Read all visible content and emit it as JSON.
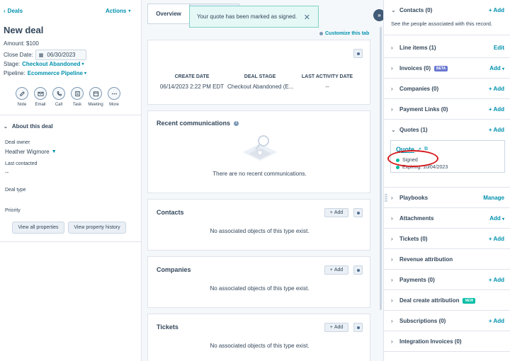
{
  "left": {
    "back_label": "Deals",
    "actions_label": "Actions",
    "title": "New deal",
    "amount": "Amount: $100",
    "close_date_label": "Close Date:",
    "close_date_value": "06/30/2023",
    "stage_label": "Stage:",
    "stage_value": "Checkout Abandoned",
    "pipeline_label": "Pipeline:",
    "pipeline_value": "Ecommerce Pipeline",
    "activities": [
      {
        "label": "Note",
        "icon": "pencil-icon"
      },
      {
        "label": "Email",
        "icon": "envelope-icon"
      },
      {
        "label": "Call",
        "icon": "phone-icon"
      },
      {
        "label": "Task",
        "icon": "task-icon"
      },
      {
        "label": "Meeting",
        "icon": "calendar-icon"
      },
      {
        "label": "More",
        "icon": "more-icon"
      }
    ],
    "about_title": "About this deal",
    "deal_owner_label": "Deal owner",
    "deal_owner_value": "Heather Wigmore",
    "last_contacted_label": "Last contacted",
    "last_contacted_value": "--",
    "deal_type_label": "Deal type",
    "priority_label": "Priority",
    "view_all_label": "View all properties",
    "view_history_label": "View property history"
  },
  "middle": {
    "tab_overview": "Overview",
    "toast_text": "Your quote has been marked as signed.",
    "customize_label": "Customize this tab",
    "summary": {
      "create_date_header": "CREATE DATE",
      "create_date_value": "06/14/2023 2:22 PM EDT",
      "deal_stage_header": "DEAL STAGE",
      "deal_stage_value": "Checkout Abandoned (E...",
      "last_activity_header": "LAST ACTIVITY DATE",
      "last_activity_value": "--"
    },
    "recent_title": "Recent communications",
    "recent_empty": "There are no recent communications.",
    "contacts_title": "Contacts",
    "contacts_empty": "No associated objects of this type exist.",
    "companies_title": "Companies",
    "companies_empty": "No associated objects of this type exist.",
    "tickets_title": "Tickets",
    "tickets_empty": "No associated objects of this type exist.",
    "add_label": "Add",
    "add_plus": "+"
  },
  "right": {
    "contacts_title": "Contacts (0)",
    "contacts_action": "+ Add",
    "contacts_desc": "See the people associated with this record.",
    "line_items_title": "Line items (1)",
    "line_items_action": "Edit",
    "invoices_title": "Invoices (0)",
    "invoices_badge": "BETA",
    "invoices_action": "Add",
    "companies_title": "Companies (0)",
    "companies_action": "+ Add",
    "payment_links_title": "Payment Links (0)",
    "payment_links_action": "+ Add",
    "quotes_title": "Quotes (1)",
    "quotes_action": "+ Add",
    "quote_name": "Quote",
    "quote_status": "Signed",
    "quote_expiring": "Expiring: 10/04/2023",
    "playbooks_title": "Playbooks",
    "playbooks_action": "Manage",
    "attachments_title": "Attachments",
    "attachments_action": "Add",
    "tickets_title": "Tickets (0)",
    "tickets_action": "+ Add",
    "revenue_title": "Revenue attribution",
    "payments_title": "Payments (0)",
    "payments_action": "+ Add",
    "deal_create_title": "Deal create attribution",
    "deal_create_badge": "NEW",
    "subscriptions_title": "Subscriptions (0)",
    "subscriptions_action": "+ Add",
    "integration_title": "Integration Invoices (0)"
  },
  "colors": {
    "link": "#0091ae",
    "text": "#33475b",
    "toast_bg": "#e5f8f6",
    "status_green": "#00bda5",
    "beta_badge": "#6a78d1",
    "new_badge": "#00bda5",
    "highlight_ring": "#d6191b"
  }
}
